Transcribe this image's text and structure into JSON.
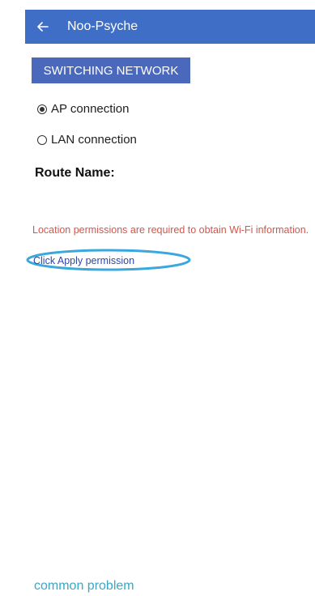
{
  "app_bar": {
    "title": "Noo-Psyche",
    "back_icon": "arrow-left-icon",
    "color": "#3f6ec6"
  },
  "switch_button": {
    "label": "SWITCHING NETWORK",
    "color": "#4a68bc"
  },
  "connection_options": [
    {
      "label": "AP connection",
      "selected": true
    },
    {
      "label": "LAN connection",
      "selected": false
    }
  ],
  "route": {
    "label": "Route Name:"
  },
  "permission": {
    "message": "Location permissions are required to obtain Wi-Fi information.",
    "message_color": "#d0574b",
    "link_label": "Click Apply permission",
    "link_color": "#2c46a8",
    "highlight_color": "#3aa7dd"
  },
  "footer": {
    "link_label": "common problem",
    "link_color": "#3aa7c6"
  }
}
